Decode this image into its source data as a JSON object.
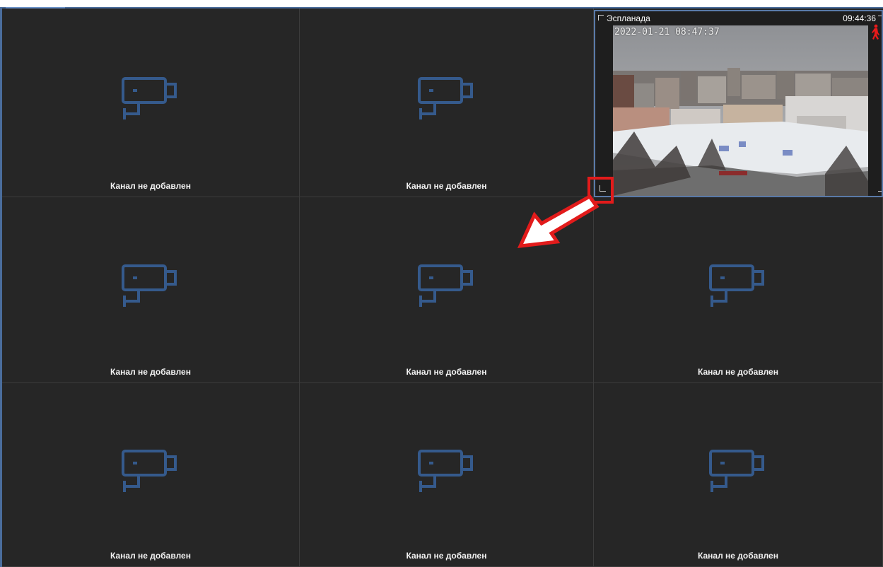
{
  "grid": {
    "empty_label": "Канал не добавлен",
    "cells": [
      {
        "label": "Канал не добавлен"
      },
      {
        "label": "Канал не добавлен"
      },
      {
        "label": "Канал не добавлен"
      },
      {
        "label": "Канал не добавлен"
      },
      {
        "label": "Канал не добавлен"
      },
      {
        "label": "Канал не добавлен"
      },
      {
        "label": "Канал не добавлен"
      },
      {
        "label": "Канал не добавлен"
      }
    ]
  },
  "live_channel": {
    "name": "Эспланада",
    "time": "09:44:36",
    "video_timestamp": "2022-01-21 08:47:37",
    "motion_icon": "walking-person-icon"
  },
  "annotation": {
    "highlight_color": "#e21b1b",
    "arrow_icon": "arrow-down-left-icon"
  },
  "colors": {
    "camera_icon": "#355a8c",
    "accent": "#4a6d9c"
  }
}
